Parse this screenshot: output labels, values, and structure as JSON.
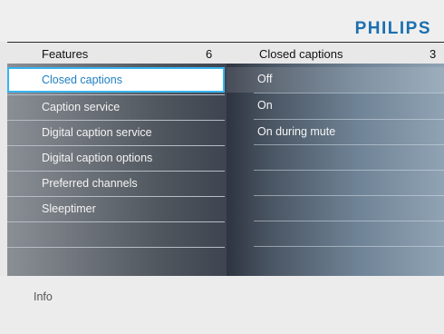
{
  "brand": "PHILIPS",
  "left_header": {
    "title": "Features",
    "count": "6"
  },
  "right_header": {
    "title": "Closed captions",
    "count": "3"
  },
  "features": [
    {
      "label": "Closed captions",
      "selected": true
    },
    {
      "label": "Caption service"
    },
    {
      "label": "Digital caption service"
    },
    {
      "label": "Digital caption options"
    },
    {
      "label": "Preferred channels"
    },
    {
      "label": "Sleeptimer"
    },
    {
      "label": ""
    },
    {
      "label": ""
    }
  ],
  "options": [
    {
      "label": "Off"
    },
    {
      "label": "On"
    },
    {
      "label": "On during mute"
    },
    {
      "label": ""
    },
    {
      "label": ""
    },
    {
      "label": ""
    },
    {
      "label": ""
    },
    {
      "label": ""
    }
  ],
  "footer": {
    "info": "Info"
  }
}
